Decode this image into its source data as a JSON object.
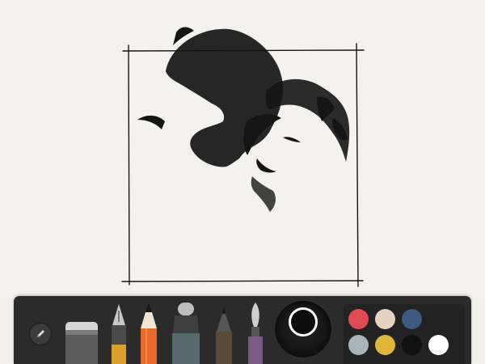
{
  "app": {
    "canvas": {
      "background": "#f3f2ee"
    },
    "toolbar": {
      "tools": [
        {
          "id": "menu",
          "icon": "pencil-icon"
        },
        {
          "id": "eraser",
          "icon": "eraser-icon"
        },
        {
          "id": "fountain-pen",
          "icon": "fountain-pen-icon",
          "band_color": "#d9a02b"
        },
        {
          "id": "pencil",
          "icon": "pencil-tool-icon",
          "band_color": "#e86a2a"
        },
        {
          "id": "marker",
          "icon": "marker-icon",
          "band_color": "#566a6e"
        },
        {
          "id": "pen",
          "icon": "pen-icon",
          "band_color": "#5b4a3a"
        },
        {
          "id": "brush",
          "icon": "brush-icon",
          "band_color": "#7b5a86"
        }
      ],
      "color_wheel": {
        "selected_color": "#0d0d0d"
      },
      "palette": [
        "#e14a55",
        "#e6d2c1",
        "#3d5a80",
        "#a8b4bb",
        "#e0b63a",
        "#111111",
        "#ffffff"
      ]
    }
  }
}
